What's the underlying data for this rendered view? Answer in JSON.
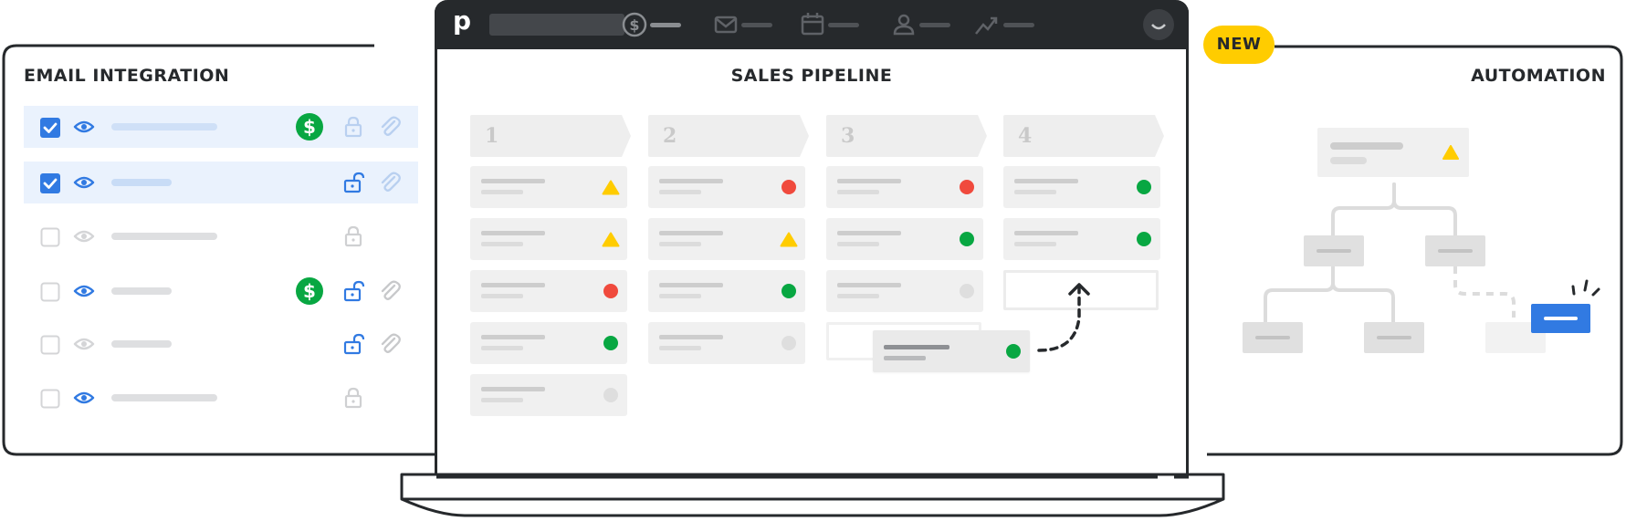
{
  "email_integration": {
    "title": "EMAIL INTEGRATION",
    "rows": [
      {
        "checked": true,
        "visible": true,
        "highlighted": true,
        "deal_linked": true,
        "lock": "faded",
        "attachment": "faded"
      },
      {
        "checked": true,
        "visible": true,
        "highlighted": true,
        "deal_linked": false,
        "lock": "unlocked",
        "attachment": "faded"
      },
      {
        "checked": false,
        "visible": false,
        "highlighted": false,
        "deal_linked": false,
        "lock": "locked",
        "attachment": "none"
      },
      {
        "checked": false,
        "visible": true,
        "highlighted": false,
        "deal_linked": true,
        "lock": "unlocked",
        "attachment": "grey"
      },
      {
        "checked": false,
        "visible": false,
        "highlighted": false,
        "deal_linked": false,
        "lock": "unlocked",
        "attachment": "grey"
      },
      {
        "checked": false,
        "visible": true,
        "highlighted": false,
        "deal_linked": false,
        "lock": "locked",
        "attachment": "none"
      }
    ]
  },
  "app": {
    "logo": "p",
    "nav_icons": [
      "deals-icon",
      "mail-icon",
      "calendar-icon",
      "contacts-icon",
      "insights-icon"
    ]
  },
  "sales_pipeline": {
    "title": "SALES PIPELINE",
    "stages": [
      {
        "label": "1",
        "cards": [
          "warning",
          "warning",
          "red",
          "green",
          "grey"
        ]
      },
      {
        "label": "2",
        "cards": [
          "red",
          "warning",
          "green",
          "grey"
        ]
      },
      {
        "label": "3",
        "cards": [
          "red",
          "green",
          "grey"
        ]
      },
      {
        "label": "4",
        "cards": [
          "green",
          "green"
        ]
      }
    ],
    "dragged_card": {
      "status": "green",
      "from_stage": "3",
      "to_stage": "4"
    }
  },
  "automation": {
    "badge": "NEW",
    "title": "AUTOMATION"
  },
  "colors": {
    "outline": "#26292c",
    "topbar": "#26292c",
    "green": "#08a742",
    "red": "#f04a3d",
    "yellow": "#ffcc00",
    "blue": "#317ae2",
    "light_blue": "#eaf2fd"
  }
}
